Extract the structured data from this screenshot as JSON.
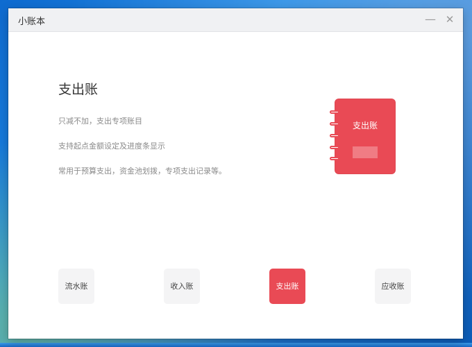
{
  "window": {
    "title": "小账本",
    "minimize_glyph": "—",
    "close_glyph": "✕"
  },
  "content": {
    "heading": "支出账",
    "descriptions": [
      "只减不加，支出专项账目",
      "支持起点金额设定及进度条显示",
      "常用于预算支出，资金池划拨，专项支出记录等。"
    ],
    "illustration_label": "支出账"
  },
  "tabs": [
    {
      "label": "流水账",
      "active": false
    },
    {
      "label": "收入账",
      "active": false
    },
    {
      "label": "支出账",
      "active": true
    },
    {
      "label": "应收账",
      "active": false
    }
  ],
  "colors": {
    "accent": "#e94a55",
    "tab_inactive_bg": "#f4f4f5",
    "titlebar_bg": "#f0f1f3"
  }
}
